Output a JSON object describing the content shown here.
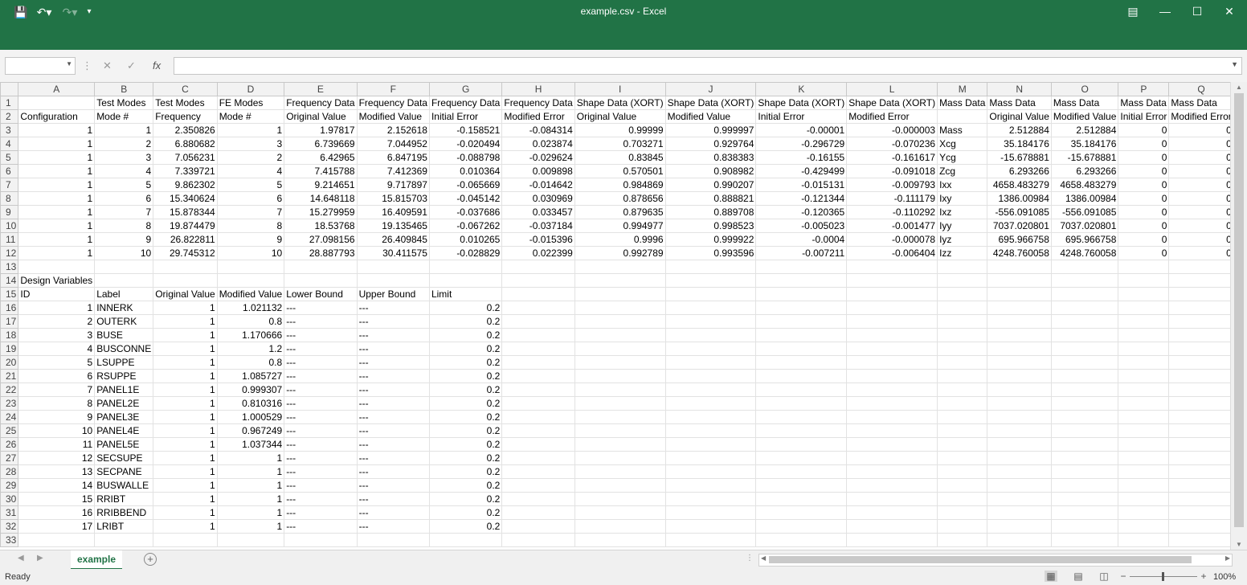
{
  "window": {
    "title": "example.csv  -  Excel"
  },
  "qat": {
    "save_icon": "save-icon",
    "undo_icon": "undo-icon",
    "redo_icon": "redo-icon",
    "customize_icon": "customize-icon"
  },
  "formula_bar": {
    "name_box": "",
    "formula": "",
    "fx": "fx"
  },
  "columns": [
    "A",
    "B",
    "C",
    "D",
    "E",
    "F",
    "G",
    "H",
    "I",
    "J",
    "K",
    "L",
    "M",
    "N",
    "O",
    "P",
    "Q"
  ],
  "rows": [
    [
      "",
      "Test Modes",
      "Test Modes",
      "FE Modes",
      "Frequency Data",
      "Frequency Data",
      "Frequency Data",
      "Frequency Data",
      "Shape Data (XORT)",
      "Shape Data (XORT)",
      "Shape Data (XORT)",
      "Shape Data (XORT)",
      "Mass Data",
      "Mass Data",
      "Mass Data",
      "Mass Data",
      "Mass Data"
    ],
    [
      "Configuration",
      "Mode #",
      "Frequency",
      "Mode #",
      "Original Value",
      "Modified Value",
      "Initial Error",
      "Modified Error",
      "Original Value",
      "Modified Value",
      "Initial Error",
      "Modified Error",
      "",
      "Original Value",
      "Modified Value",
      "Initial Error",
      "Modified Error"
    ],
    [
      "1",
      "1",
      "2.350826",
      "1",
      "1.97817",
      "2.152618",
      "-0.158521",
      "-0.084314",
      "0.99999",
      "0.999997",
      "-0.00001",
      "-0.000003",
      "Mass",
      "2.512884",
      "2.512884",
      "0",
      "0"
    ],
    [
      "1",
      "2",
      "6.880682",
      "3",
      "6.739669",
      "7.044952",
      "-0.020494",
      "0.023874",
      "0.703271",
      "0.929764",
      "-0.296729",
      "-0.070236",
      "Xcg",
      "35.184176",
      "35.184176",
      "0",
      "0"
    ],
    [
      "1",
      "3",
      "7.056231",
      "2",
      "6.42965",
      "6.847195",
      "-0.088798",
      "-0.029624",
      "0.83845",
      "0.838383",
      "-0.16155",
      "-0.161617",
      "Ycg",
      "-15.678881",
      "-15.678881",
      "0",
      "0"
    ],
    [
      "1",
      "4",
      "7.339721",
      "4",
      "7.415788",
      "7.412369",
      "0.010364",
      "0.009898",
      "0.570501",
      "0.908982",
      "-0.429499",
      "-0.091018",
      "Zcg",
      "6.293266",
      "6.293266",
      "0",
      "0"
    ],
    [
      "1",
      "5",
      "9.862302",
      "5",
      "9.214651",
      "9.717897",
      "-0.065669",
      "-0.014642",
      "0.984869",
      "0.990207",
      "-0.015131",
      "-0.009793",
      "Ixx",
      "4658.483279",
      "4658.483279",
      "0",
      "0"
    ],
    [
      "1",
      "6",
      "15.340624",
      "6",
      "14.648118",
      "15.815703",
      "-0.045142",
      "0.030969",
      "0.878656",
      "0.888821",
      "-0.121344",
      "-0.111179",
      "Ixy",
      "1386.00984",
      "1386.00984",
      "0",
      "0"
    ],
    [
      "1",
      "7",
      "15.878344",
      "7",
      "15.279959",
      "16.409591",
      "-0.037686",
      "0.033457",
      "0.879635",
      "0.889708",
      "-0.120365",
      "-0.110292",
      "Ixz",
      "-556.091085",
      "-556.091085",
      "0",
      "0"
    ],
    [
      "1",
      "8",
      "19.874479",
      "8",
      "18.53768",
      "19.135465",
      "-0.067262",
      "-0.037184",
      "0.994977",
      "0.998523",
      "-0.005023",
      "-0.001477",
      "Iyy",
      "7037.020801",
      "7037.020801",
      "0",
      "0"
    ],
    [
      "1",
      "9",
      "26.822811",
      "9",
      "27.098156",
      "26.409845",
      "0.010265",
      "-0.015396",
      "0.9996",
      "0.999922",
      "-0.0004",
      "-0.000078",
      "Iyz",
      "695.966758",
      "695.966758",
      "0",
      "0"
    ],
    [
      "1",
      "10",
      "29.745312",
      "10",
      "28.887793",
      "30.411575",
      "-0.028829",
      "0.022399",
      "0.992789",
      "0.993596",
      "-0.007211",
      "-0.006404",
      "Izz",
      "4248.760058",
      "4248.760058",
      "0",
      "0"
    ],
    [
      "",
      "",
      "",
      "",
      "",
      "",
      "",
      "",
      "",
      "",
      "",
      "",
      "",
      "",
      "",
      "",
      ""
    ],
    [
      "Design Variables",
      "",
      "",
      "",
      "",
      "",
      "",
      "",
      "",
      "",
      "",
      "",
      "",
      "",
      "",
      "",
      ""
    ],
    [
      "ID",
      "Label",
      "Original Value",
      "Modified Value",
      "Lower Bound",
      "Upper Bound",
      "Limit",
      "",
      "",
      "",
      "",
      "",
      "",
      "",
      "",
      "",
      ""
    ],
    [
      "1",
      "INNERK",
      "1",
      "1.021132",
      "---",
      "---",
      "0.2",
      "",
      "",
      "",
      "",
      "",
      "",
      "",
      "",
      "",
      ""
    ],
    [
      "2",
      "OUTERK",
      "1",
      "0.8",
      "---",
      "---",
      "0.2",
      "",
      "",
      "",
      "",
      "",
      "",
      "",
      "",
      "",
      ""
    ],
    [
      "3",
      "BUSE",
      "1",
      "1.170666",
      "---",
      "---",
      "0.2",
      "",
      "",
      "",
      "",
      "",
      "",
      "",
      "",
      "",
      ""
    ],
    [
      "4",
      "BUSCONNE",
      "1",
      "1.2",
      "---",
      "---",
      "0.2",
      "",
      "",
      "",
      "",
      "",
      "",
      "",
      "",
      "",
      ""
    ],
    [
      "5",
      "LSUPPE",
      "1",
      "0.8",
      "---",
      "---",
      "0.2",
      "",
      "",
      "",
      "",
      "",
      "",
      "",
      "",
      "",
      ""
    ],
    [
      "6",
      "RSUPPE",
      "1",
      "1.085727",
      "---",
      "---",
      "0.2",
      "",
      "",
      "",
      "",
      "",
      "",
      "",
      "",
      "",
      ""
    ],
    [
      "7",
      "PANEL1E",
      "1",
      "0.999307",
      "---",
      "---",
      "0.2",
      "",
      "",
      "",
      "",
      "",
      "",
      "",
      "",
      "",
      ""
    ],
    [
      "8",
      "PANEL2E",
      "1",
      "0.810316",
      "---",
      "---",
      "0.2",
      "",
      "",
      "",
      "",
      "",
      "",
      "",
      "",
      "",
      ""
    ],
    [
      "9",
      "PANEL3E",
      "1",
      "1.000529",
      "---",
      "---",
      "0.2",
      "",
      "",
      "",
      "",
      "",
      "",
      "",
      "",
      "",
      ""
    ],
    [
      "10",
      "PANEL4E",
      "1",
      "0.967249",
      "---",
      "---",
      "0.2",
      "",
      "",
      "",
      "",
      "",
      "",
      "",
      "",
      "",
      ""
    ],
    [
      "11",
      "PANEL5E",
      "1",
      "1.037344",
      "---",
      "---",
      "0.2",
      "",
      "",
      "",
      "",
      "",
      "",
      "",
      "",
      "",
      ""
    ],
    [
      "12",
      "SECSUPE",
      "1",
      "1",
      "---",
      "---",
      "0.2",
      "",
      "",
      "",
      "",
      "",
      "",
      "",
      "",
      "",
      ""
    ],
    [
      "13",
      "SECPANE",
      "1",
      "1",
      "---",
      "---",
      "0.2",
      "",
      "",
      "",
      "",
      "",
      "",
      "",
      "",
      "",
      ""
    ],
    [
      "14",
      "BUSWALLE",
      "1",
      "1",
      "---",
      "---",
      "0.2",
      "",
      "",
      "",
      "",
      "",
      "",
      "",
      "",
      "",
      ""
    ],
    [
      "15",
      "RRIBT",
      "1",
      "1",
      "---",
      "---",
      "0.2",
      "",
      "",
      "",
      "",
      "",
      "",
      "",
      "",
      "",
      ""
    ],
    [
      "16",
      "RRIBBEND",
      "1",
      "1",
      "---",
      "---",
      "0.2",
      "",
      "",
      "",
      "",
      "",
      "",
      "",
      "",
      "",
      ""
    ],
    [
      "17",
      "LRIBT",
      "1",
      "1",
      "---",
      "---",
      "0.2",
      "",
      "",
      "",
      "",
      "",
      "",
      "",
      "",
      "",
      ""
    ],
    [
      "",
      "",
      "",
      "",
      "",
      "",
      "",
      "",
      "",
      "",
      "",
      "",
      "",
      "",
      "",
      "",
      ""
    ]
  ],
  "sheet_tabs": [
    {
      "label": "example",
      "active": true
    }
  ],
  "status": {
    "ready": "Ready",
    "zoom": "100%"
  }
}
